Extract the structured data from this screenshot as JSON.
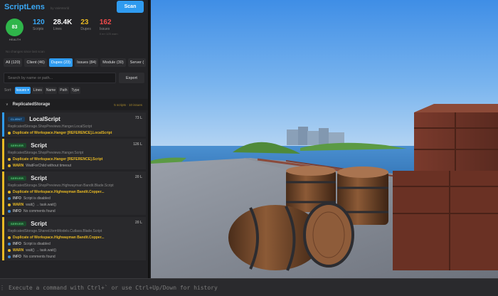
{
  "panel": {
    "brand": "ScriptLens",
    "byline": "by ValeWorld",
    "scan_label": "Scan",
    "health": {
      "value": "83",
      "label": "HEALTH"
    },
    "stats": [
      {
        "num": "120",
        "label": "Scripts",
        "color": "#3aa8f5"
      },
      {
        "num": "28.4K",
        "label": "Lines",
        "color": "#ffffff"
      },
      {
        "num": "23",
        "label": "Dupes",
        "color": "#e8b923"
      },
      {
        "num": "162",
        "label": "Issues",
        "color": "#f04b4b",
        "sub": "0 err 125 warn"
      }
    ],
    "no_changes": "No changes since last scan",
    "filters": [
      "All (120)",
      "Client (46)",
      "Dupes (23)",
      "Issues (84)",
      "Module (30)",
      "Server ("
    ],
    "active_filter": "Dupes (23)",
    "search_placeholder": "Search by name or path...",
    "export_label": "Export",
    "sort_label": "Sort:",
    "sort_options": [
      "Issues ▾",
      "Lines",
      "Name",
      "Path",
      "Type"
    ],
    "group": {
      "name": "ReplicatedStorage",
      "meta": "5 scripts · 10 issues"
    },
    "cards": [
      {
        "badge": "CLIENT",
        "title": "LocalScript",
        "lines": "73 L",
        "path": "ReplicatedStorage.ShopPreviews.Hanger.LocalScript",
        "dup": "Duplicate of Workspace.Hanger [REFERENCE].LocalScript",
        "issues": []
      },
      {
        "badge": "SERVER",
        "title": "Script",
        "lines": "126 L",
        "path": "ReplicatedStorage.ShopPreviews.Hanger.Script",
        "dup": "Duplicate of Workspace.Hanger [REFERENCE].Script",
        "issues": [
          {
            "tag": "WARN",
            "text": "WaitForChild without timeout"
          }
        ]
      },
      {
        "badge": "SERVER",
        "title": "Script",
        "lines": "20 L",
        "path": "ReplicatedStorage.ShopPreviews.Highwayman Bandit.Blade.Script",
        "dup": "Duplicate of Workspace.Highwayman Bandit.Copper...",
        "issues": [
          {
            "tag": "INFO",
            "text": "Script is disabled"
          },
          {
            "tag": "WARN",
            "text": "wait() → task.wait()"
          },
          {
            "tag": "INFO",
            "text": "No comments found"
          }
        ]
      },
      {
        "badge": "SERVER",
        "title": "Script",
        "lines": "20 L",
        "path": "ReplicatedStorage.Shared.ItemModels.Cutlass.Blade.Script",
        "dup": "Duplicate of Workspace.Highwayman Bandit.Copper...",
        "issues": [
          {
            "tag": "INFO",
            "text": "Script is disabled"
          },
          {
            "tag": "WARN",
            "text": "wait() → task.wait()"
          },
          {
            "tag": "INFO",
            "text": "No comments found"
          }
        ]
      }
    ]
  },
  "command_bar": {
    "placeholder": "Execute a command with Ctrl+` or use Ctrl+Up/Down for history"
  },
  "colors": {
    "accent": "#2f9bf0",
    "dupe": "#e8b923",
    "health": "#2fb54a",
    "issues": "#f04b4b"
  }
}
